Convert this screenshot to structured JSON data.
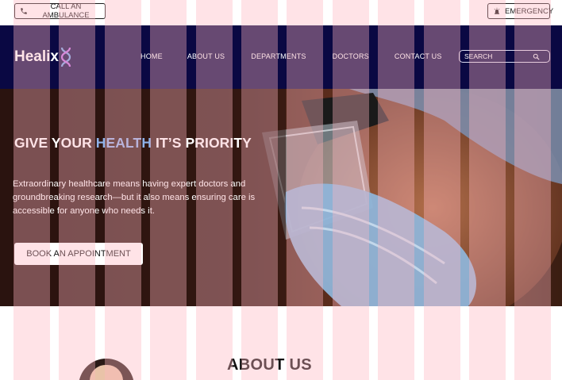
{
  "topbar": {
    "ambulance_label": "CALL AN AMBULANCE",
    "ambulance_icon": "phone-icon",
    "emergency_label": "EMERGENCY",
    "emergency_icon": "siren-icon"
  },
  "nav": {
    "logo_text": "Healix",
    "logo_icon": "dna-icon",
    "links": [
      "HOME",
      "ABOUT US",
      "DEPARTMENTS",
      "DOCTORS",
      "CONTACT US"
    ],
    "search_placeholder": "SEARCH",
    "search_icon": "search-icon"
  },
  "hero": {
    "title_before": "GIVE YOUR ",
    "title_accent": "HEALTH",
    "title_after": " IT’S PRIORITY",
    "description": "Extraordinary healthcare means having expert doctors and groundbreaking research—but it also means ensuring care is accessible for anyone who needs it.",
    "cta_label": "BOOK AN APPOINTMENT"
  },
  "about": {
    "title": "ABOUT US"
  },
  "colors": {
    "nav_bg": "#0a0843",
    "accent": "#8fb2ea",
    "grid_overlay": "rgba(255,182,193,0.38)"
  }
}
